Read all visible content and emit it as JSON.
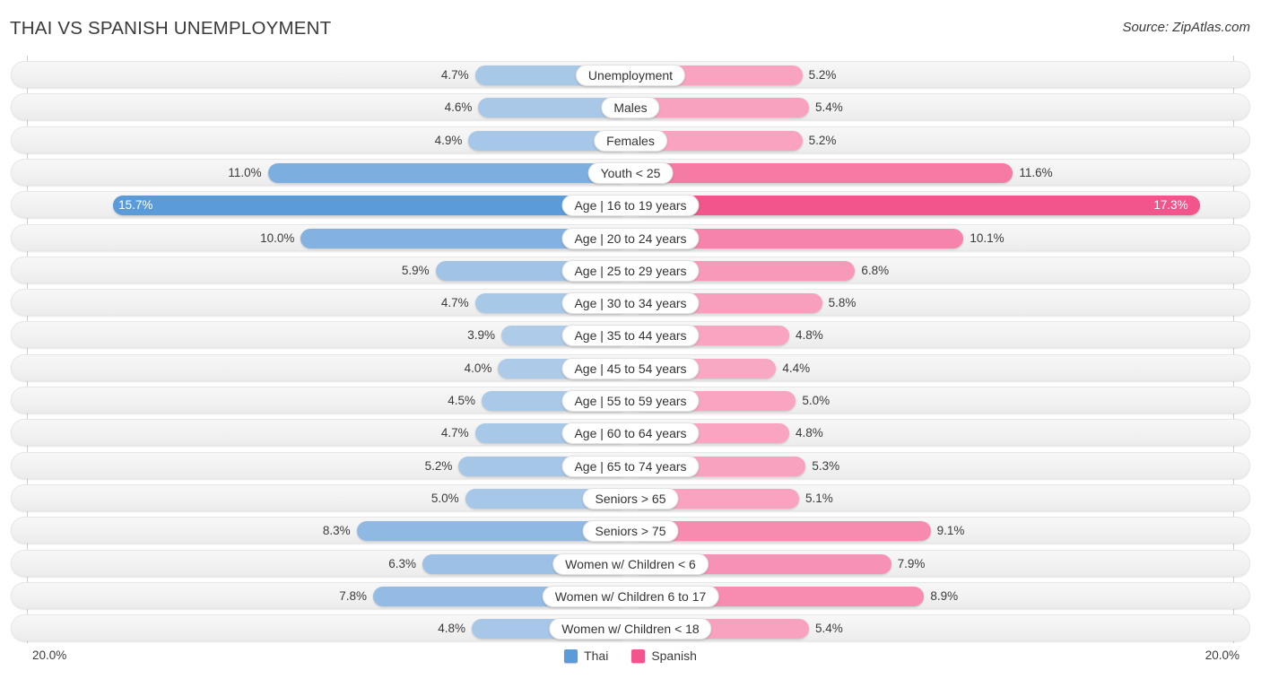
{
  "header": {
    "title": "THAI VS SPANISH UNEMPLOYMENT",
    "source": "Source: ZipAtlas.com"
  },
  "legend": {
    "items": [
      {
        "label": "Thai",
        "color": "#5b9bd9"
      },
      {
        "label": "Spanish",
        "color": "#f2558b"
      }
    ]
  },
  "axis": {
    "min_label": "20.0%",
    "max_label": "20.0%",
    "max_value": 20.0
  },
  "chart_data": {
    "type": "bar",
    "orientation": "diverging-horizontal",
    "title": "THAI VS SPANISH UNEMPLOYMENT",
    "xlabel": "",
    "ylabel": "",
    "xlim": [
      20.0,
      20.0
    ],
    "grid": false,
    "legend_position": "bottom-center",
    "categories": [
      "Unemployment",
      "Males",
      "Females",
      "Youth < 25",
      "Age | 16 to 19 years",
      "Age | 20 to 24 years",
      "Age | 25 to 29 years",
      "Age | 30 to 34 years",
      "Age | 35 to 44 years",
      "Age | 45 to 54 years",
      "Age | 55 to 59 years",
      "Age | 60 to 64 years",
      "Age | 65 to 74 years",
      "Seniors > 65",
      "Seniors > 75",
      "Women w/ Children < 6",
      "Women w/ Children 6 to 17",
      "Women w/ Children < 18"
    ],
    "series": [
      {
        "name": "Thai",
        "color": "#5b9bd9",
        "values": [
          4.7,
          4.6,
          4.9,
          11.0,
          15.7,
          10.0,
          5.9,
          4.7,
          3.9,
          4.0,
          4.5,
          4.7,
          5.2,
          5.0,
          8.3,
          6.3,
          7.8,
          4.8
        ],
        "labels": [
          "4.7%",
          "4.6%",
          "4.9%",
          "11.0%",
          "15.7%",
          "10.0%",
          "5.9%",
          "4.7%",
          "3.9%",
          "4.0%",
          "4.5%",
          "4.7%",
          "5.2%",
          "5.0%",
          "8.3%",
          "6.3%",
          "7.8%",
          "4.8%"
        ]
      },
      {
        "name": "Spanish",
        "color": "#f2558b",
        "values": [
          5.2,
          5.4,
          5.2,
          11.6,
          17.3,
          10.1,
          6.8,
          5.8,
          4.8,
          4.4,
          5.0,
          4.8,
          5.3,
          5.1,
          9.1,
          7.9,
          8.9,
          5.4
        ],
        "labels": [
          "5.2%",
          "5.4%",
          "5.2%",
          "11.6%",
          "17.3%",
          "10.1%",
          "6.8%",
          "5.8%",
          "4.8%",
          "4.4%",
          "5.0%",
          "4.8%",
          "5.3%",
          "5.1%",
          "9.1%",
          "7.9%",
          "8.9%",
          "5.4%"
        ]
      }
    ]
  }
}
